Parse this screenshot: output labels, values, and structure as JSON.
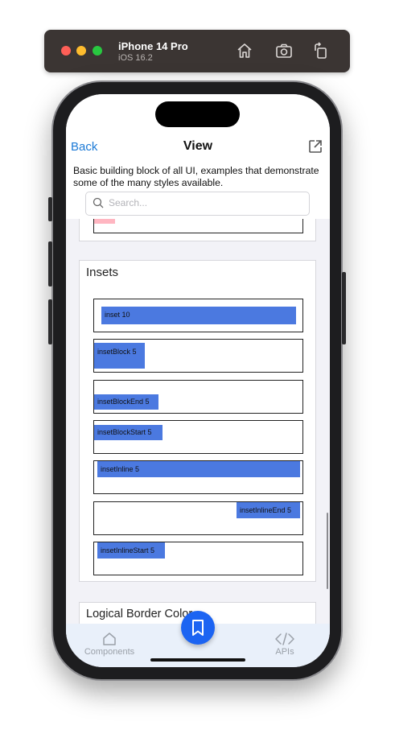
{
  "simulator": {
    "device_name": "iPhone 14 Pro",
    "os_version": "iOS 16.2",
    "icons": [
      "home-icon",
      "screenshot-icon",
      "rotate-icon"
    ]
  },
  "nav": {
    "back_label": "Back",
    "title": "View",
    "external_icon": "external-link-icon"
  },
  "description": "Basic building block of all UI, examples that demonstrate some of the many styles available.",
  "search": {
    "placeholder": "Search...",
    "value": ""
  },
  "insets_section": {
    "title": "Insets",
    "items": [
      "inset 10",
      "insetBlock 5",
      "insetBlockEnd 5",
      "insetBlockStart 5",
      "insetInline 5",
      "insetInlineEnd 5",
      "insetInlineStart 5"
    ]
  },
  "next_section": {
    "title": "Logical Border Color"
  },
  "tabbar": {
    "components_label": "Components",
    "apis_label": "APIs"
  },
  "colors": {
    "accent": "#1c7ad6",
    "fab": "#1c64f2",
    "box_fill": "#4b79e0",
    "pink_swatch": "#ffb6c1",
    "tabbar_bg": "#e9f0fa"
  }
}
